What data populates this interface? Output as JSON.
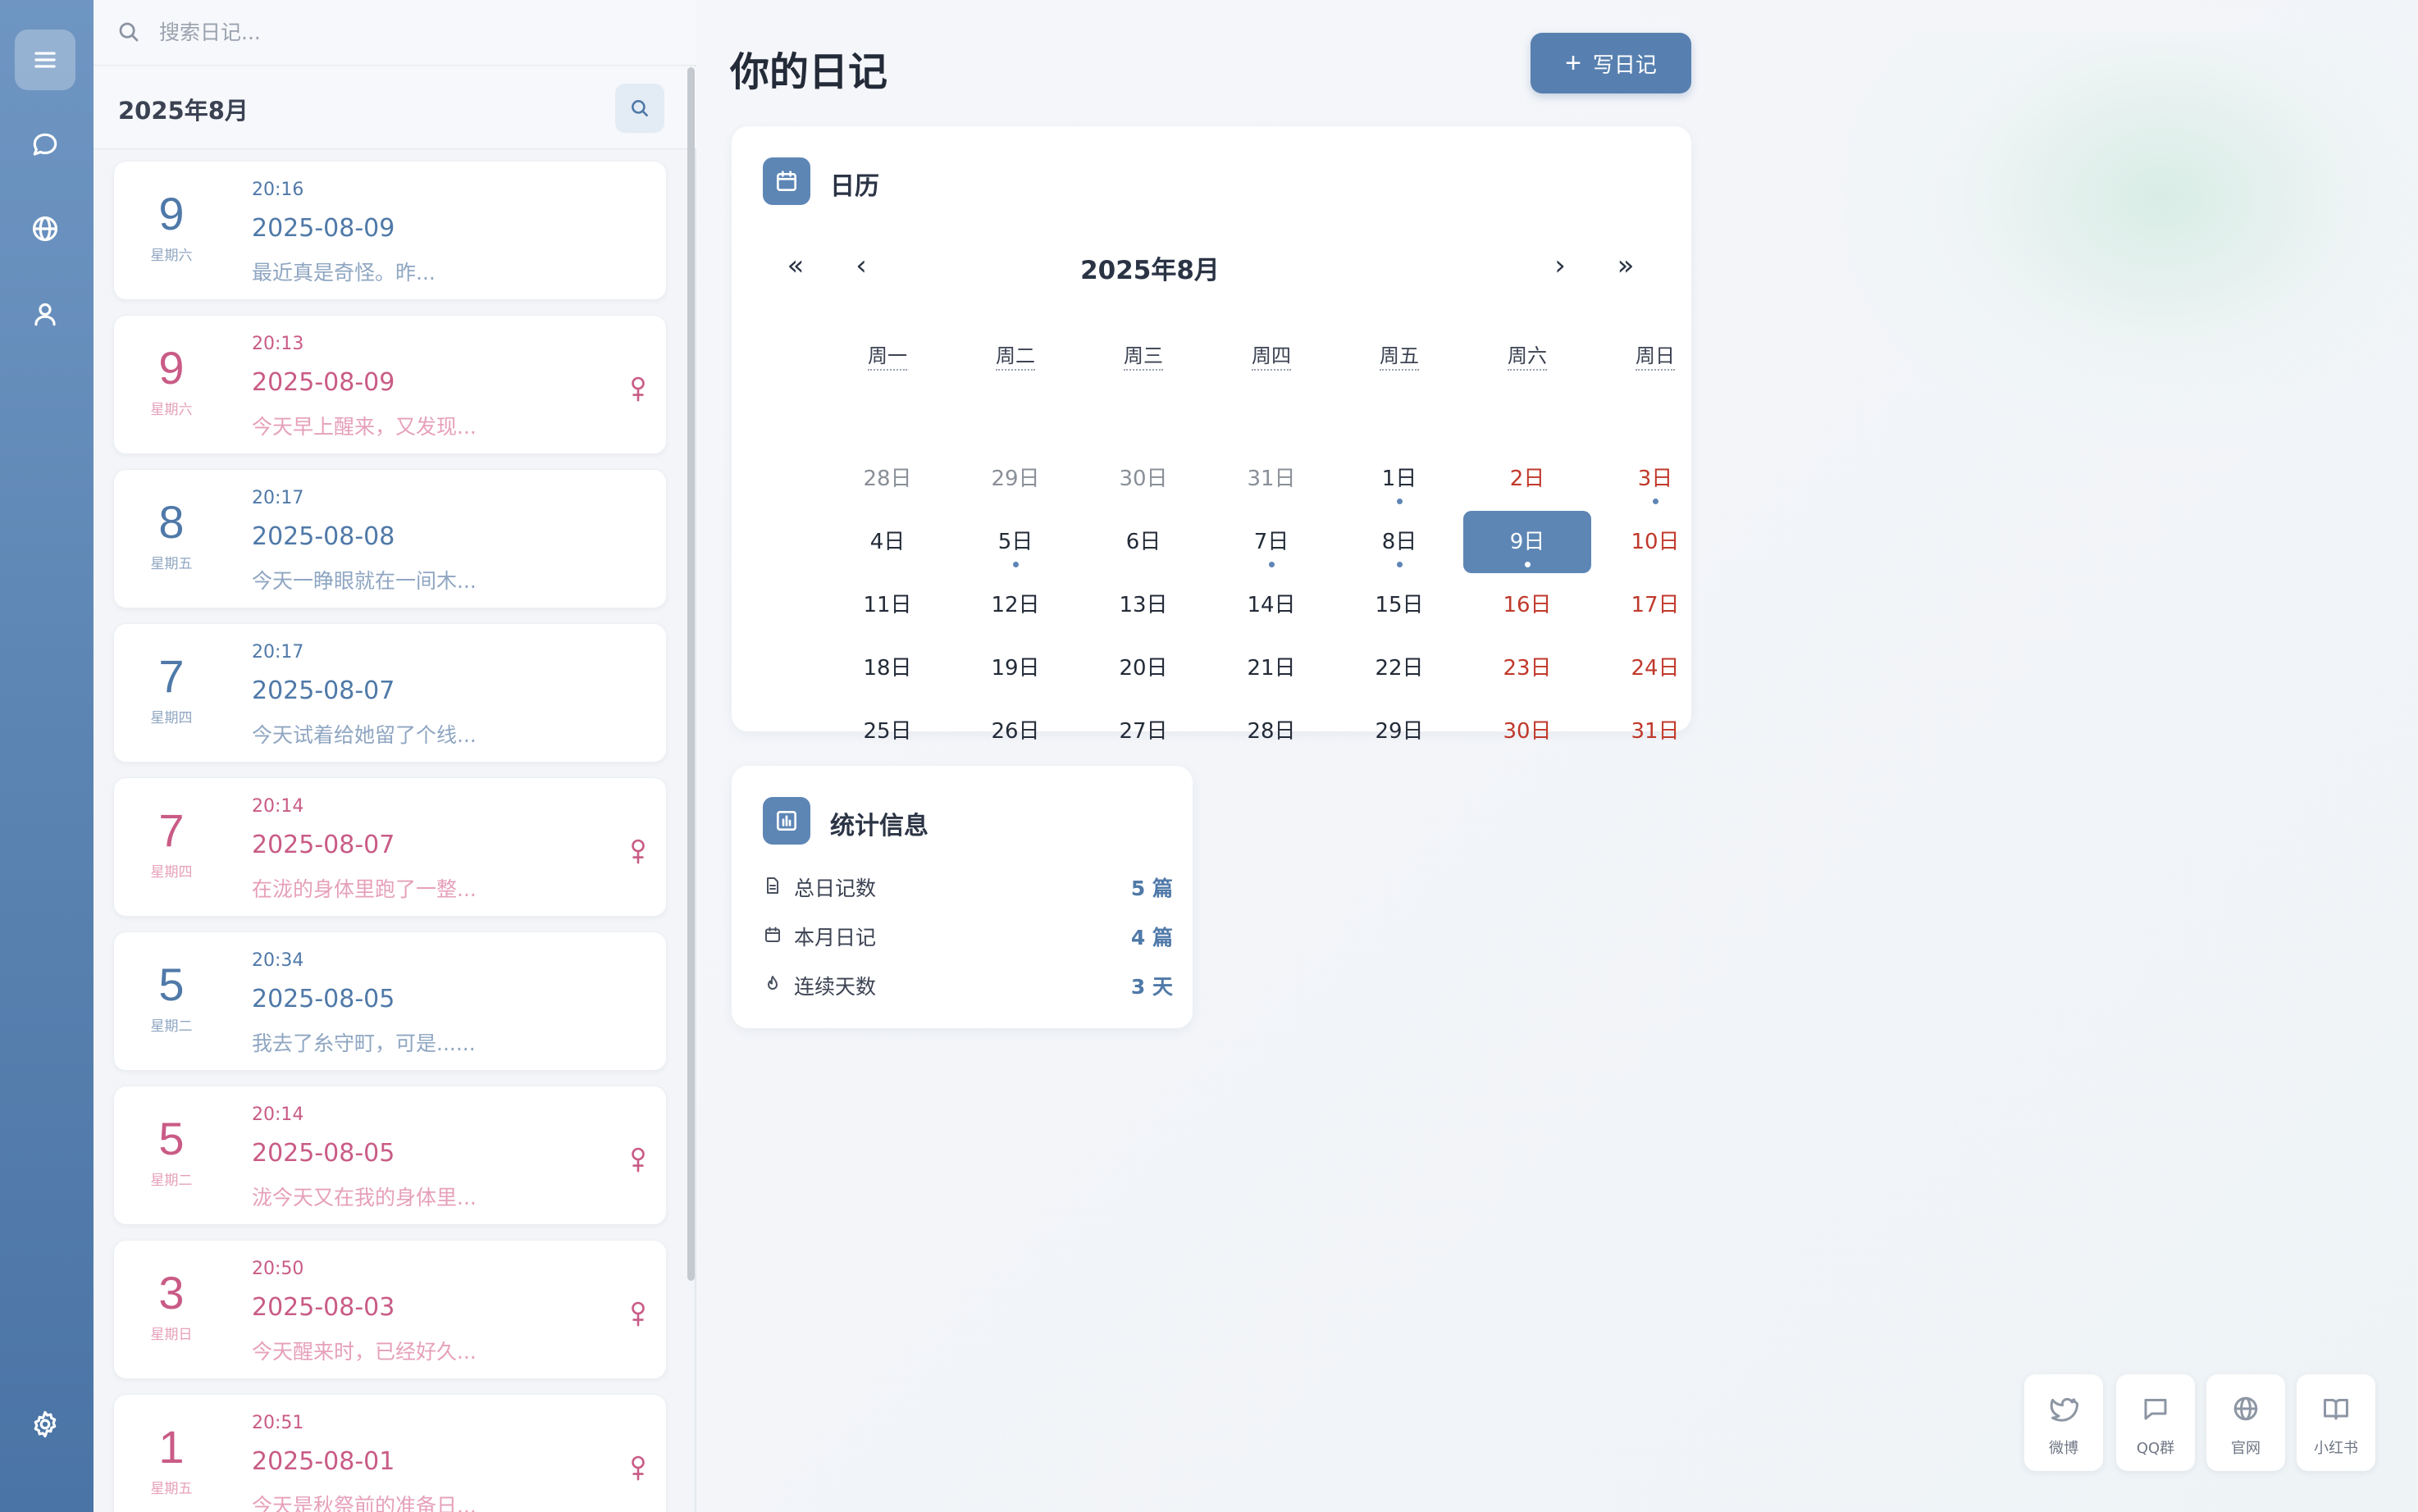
{
  "search": {
    "placeholder": "搜索日记..."
  },
  "list": {
    "month_label": "2025年8月",
    "entries": [
      {
        "day": "9",
        "weekday": "星期六",
        "time": "20:16",
        "date": "2025-08-09",
        "snippet": "最近真是奇怪。昨...",
        "female": false
      },
      {
        "day": "9",
        "weekday": "星期六",
        "time": "20:13",
        "date": "2025-08-09",
        "snippet": "今天早上醒来，又发现...",
        "female": true
      },
      {
        "day": "8",
        "weekday": "星期五",
        "time": "20:17",
        "date": "2025-08-08",
        "snippet": "今天一睁眼就在一间木...",
        "female": false
      },
      {
        "day": "7",
        "weekday": "星期四",
        "time": "20:17",
        "date": "2025-08-07",
        "snippet": "今天试着给她留了个线...",
        "female": false
      },
      {
        "day": "7",
        "weekday": "星期四",
        "time": "20:14",
        "date": "2025-08-07",
        "snippet": "在泷的身体里跑了一整...",
        "female": true
      },
      {
        "day": "5",
        "weekday": "星期二",
        "time": "20:34",
        "date": "2025-08-05",
        "snippet": "我去了糸守町，可是......",
        "female": false
      },
      {
        "day": "5",
        "weekday": "星期二",
        "time": "20:14",
        "date": "2025-08-05",
        "snippet": "泷今天又在我的身体里...",
        "female": true
      },
      {
        "day": "3",
        "weekday": "星期日",
        "time": "20:50",
        "date": "2025-08-03",
        "snippet": "今天醒来时，已经好久...",
        "female": true
      },
      {
        "day": "1",
        "weekday": "星期五",
        "time": "20:51",
        "date": "2025-08-01",
        "snippet": "今天是秋祭前的准备日...",
        "female": true
      }
    ]
  },
  "main": {
    "title": "你的日记",
    "write_button": "写日记",
    "write_icon": "+"
  },
  "calendar": {
    "title": "日历",
    "month": "2025年8月",
    "nav": {
      "prev_year": "«",
      "prev_month": "‹",
      "next_month": "›",
      "next_year": "»"
    },
    "weekdays": [
      "周一",
      "周二",
      "周三",
      "周四",
      "周五",
      "周六",
      "周日"
    ],
    "weeks": [
      [
        {
          "t": "28日",
          "s": "other"
        },
        {
          "t": "29日",
          "s": "other"
        },
        {
          "t": "30日",
          "s": "other"
        },
        {
          "t": "31日",
          "s": "other"
        },
        {
          "t": "1日",
          "dot": true
        },
        {
          "t": "2日",
          "s": "weekend"
        },
        {
          "t": "3日",
          "s": "weekend",
          "dot": true
        }
      ],
      [
        {
          "t": "4日"
        },
        {
          "t": "5日",
          "dot": true
        },
        {
          "t": "6日"
        },
        {
          "t": "7日",
          "dot": true
        },
        {
          "t": "8日",
          "dot": true
        },
        {
          "t": "9日",
          "s": "sel",
          "dot": true
        },
        {
          "t": "10日",
          "s": "weekend"
        }
      ],
      [
        {
          "t": "11日"
        },
        {
          "t": "12日"
        },
        {
          "t": "13日"
        },
        {
          "t": "14日"
        },
        {
          "t": "15日"
        },
        {
          "t": "16日",
          "s": "weekend"
        },
        {
          "t": "17日",
          "s": "weekend"
        }
      ],
      [
        {
          "t": "18日"
        },
        {
          "t": "19日"
        },
        {
          "t": "20日"
        },
        {
          "t": "21日"
        },
        {
          "t": "22日"
        },
        {
          "t": "23日",
          "s": "weekend"
        },
        {
          "t": "24日",
          "s": "weekend"
        }
      ],
      [
        {
          "t": "25日"
        },
        {
          "t": "26日"
        },
        {
          "t": "27日"
        },
        {
          "t": "28日"
        },
        {
          "t": "29日"
        },
        {
          "t": "30日",
          "s": "weekend"
        },
        {
          "t": "31日",
          "s": "weekend"
        }
      ]
    ]
  },
  "stats": {
    "title": "统计信息",
    "rows": [
      {
        "label": "总日记数",
        "value": "5 篇",
        "icon": "document-icon"
      },
      {
        "label": "本月日记",
        "value": "4 篇",
        "icon": "calendar-icon"
      },
      {
        "label": "连续天数",
        "value": "3 天",
        "icon": "flame-icon"
      }
    ]
  },
  "social": [
    {
      "label": "微博",
      "icon": "bird-icon"
    },
    {
      "label": "QQ群",
      "icon": "chat-icon"
    },
    {
      "label": "官网",
      "icon": "globe-icon"
    },
    {
      "label": "小红书",
      "icon": "book-icon"
    }
  ],
  "colors": {
    "accent": "#5780b0",
    "female": "#c95b86",
    "weekend": "#c0392b"
  }
}
